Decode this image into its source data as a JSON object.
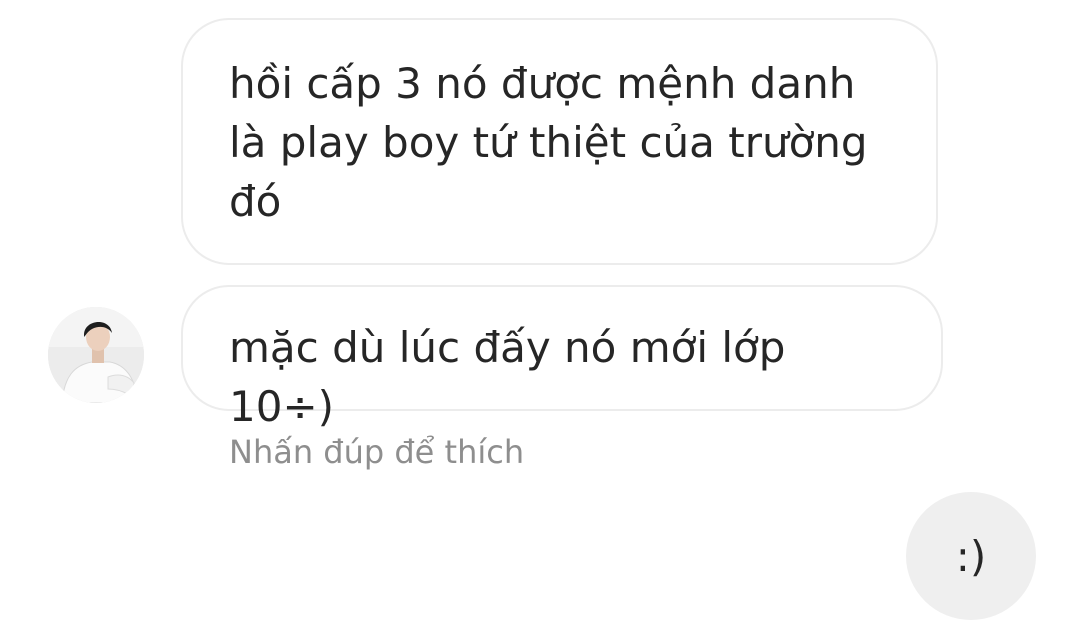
{
  "conversation": {
    "messages": [
      {
        "direction": "incoming",
        "text": "hồi cấp 3 nó được mệnh danh là play boy tứ thiệt của trường đó"
      },
      {
        "direction": "incoming",
        "text": "mặc dù lúc đấy nó mới lớp 10÷)"
      },
      {
        "direction": "outgoing",
        "text": ":)"
      }
    ],
    "double_tap_hint": "Nhấn đúp để thích",
    "avatar_icon": "user-avatar-photo"
  },
  "colors": {
    "incoming_bubble_border": "#ececec",
    "outgoing_bubble_bg": "#efefef",
    "text": "#262626",
    "hint_text": "#8e8e8e"
  }
}
